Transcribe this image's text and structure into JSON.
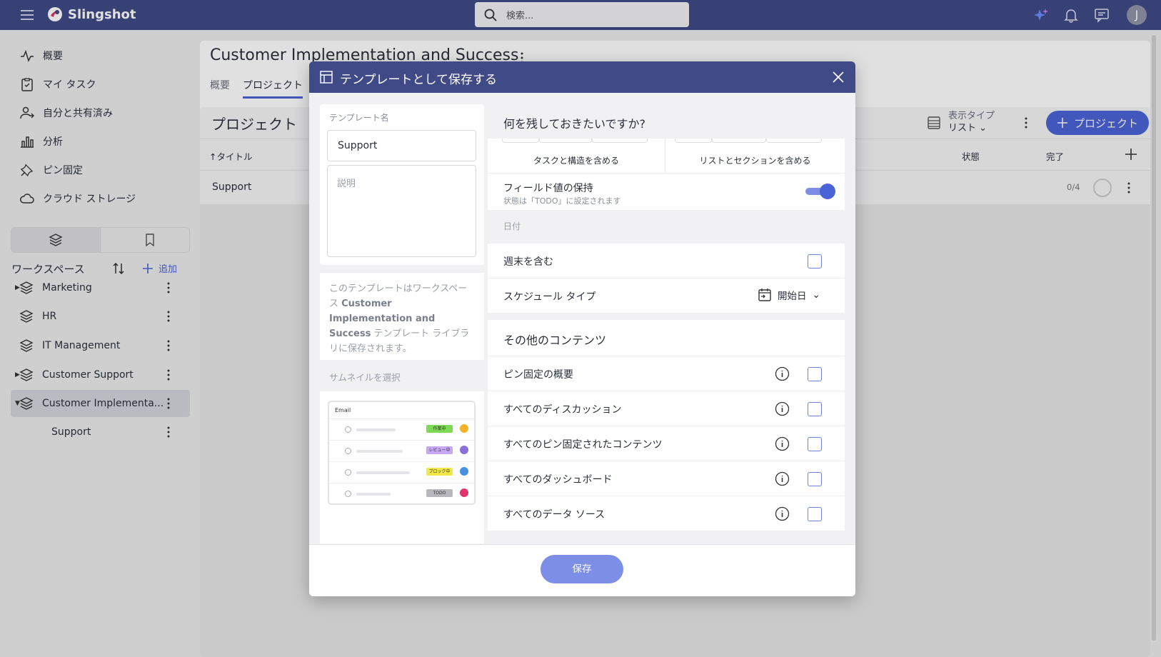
{
  "app": {
    "name": "Slingshot"
  },
  "search": {
    "placeholder": "検索..."
  },
  "user": {
    "initial": "J"
  },
  "sidebar": {
    "nav": [
      {
        "label": "概要",
        "icon": "activity-icon"
      },
      {
        "label": "マイ タスク",
        "icon": "clipboard-check-icon"
      },
      {
        "label": "自分と共有済み",
        "icon": "shared-user-icon"
      },
      {
        "label": "分析",
        "icon": "bar-chart-icon"
      },
      {
        "label": "ピン固定",
        "icon": "pin-icon"
      },
      {
        "label": "クラウド ストレージ",
        "icon": "cloud-icon"
      }
    ],
    "workspace_header": "ワークスペース",
    "add_label": "追加",
    "workspaces": [
      {
        "label": "Marketing",
        "expandable": true
      },
      {
        "label": "HR",
        "expandable": false
      },
      {
        "label": "IT Management",
        "expandable": false
      },
      {
        "label": "Customer Support",
        "expandable": true
      },
      {
        "label": "Customer Implementa...",
        "expandable": true,
        "active": true
      }
    ],
    "sub_item": "Support"
  },
  "main": {
    "title": "Customer Implementation and Success",
    "tabs": [
      "概要",
      "プロジェクト"
    ],
    "section_title": "プロジェクト",
    "view_type_label": "表示タイプ",
    "view_type_value": "リスト",
    "add_project_label": "プロジェクト",
    "columns": {
      "title": "↑タイトル",
      "status": "状態",
      "done": "完了"
    },
    "rows": [
      {
        "name": "Support",
        "count": "0/4"
      }
    ]
  },
  "dialog": {
    "title": "テンプレートとして保存する",
    "template_name_label": "テンプレート名",
    "template_name_value": "Support",
    "description_placeholder": "説明",
    "note_prefix": "このテンプレートはワークスペース ",
    "note_workspace": "Customer Implementation and Success",
    "note_suffix": " テンプレート ライブラリに保存されます。",
    "thumbnail_label": "サムネイルを選択",
    "thumbnail": {
      "title": "Email",
      "tags": [
        {
          "label": "作業中",
          "color": "#7ed957"
        },
        {
          "label": "レビュー中",
          "color": "#c6a8f5"
        },
        {
          "label": "ブロック中",
          "color": "#f2e84b"
        },
        {
          "label": "TODO",
          "color": "#b8b8bc"
        }
      ],
      "avatar_colors": [
        "#f0b429",
        "#8a6fd6",
        "#4a90e2",
        "#e0356b"
      ]
    },
    "question": "何を残しておきたいですか?",
    "include_tasks": "タスクと構造を含める",
    "include_lists": "リストとセクションを含める",
    "keep_field_values": "フィールド値の保持",
    "keep_field_values_sub": "状態は「TODO」に設定されます",
    "keep_field_values_on": true,
    "dates_label": "日付",
    "include_weekends": "週末を含む",
    "schedule_type_label": "スケジュール タイプ",
    "schedule_type_value": "開始日",
    "other_content_title": "その他のコンテンツ",
    "other_content": [
      "ピン固定の概要",
      "すべてのディスカッション",
      "すべてのピン固定されたコンテンツ",
      "すべてのダッシュボード",
      "すべてのデータ ソース"
    ],
    "save_label": "保存"
  },
  "colors": {
    "brand": "#404a86",
    "accent": "#4a63d6"
  }
}
